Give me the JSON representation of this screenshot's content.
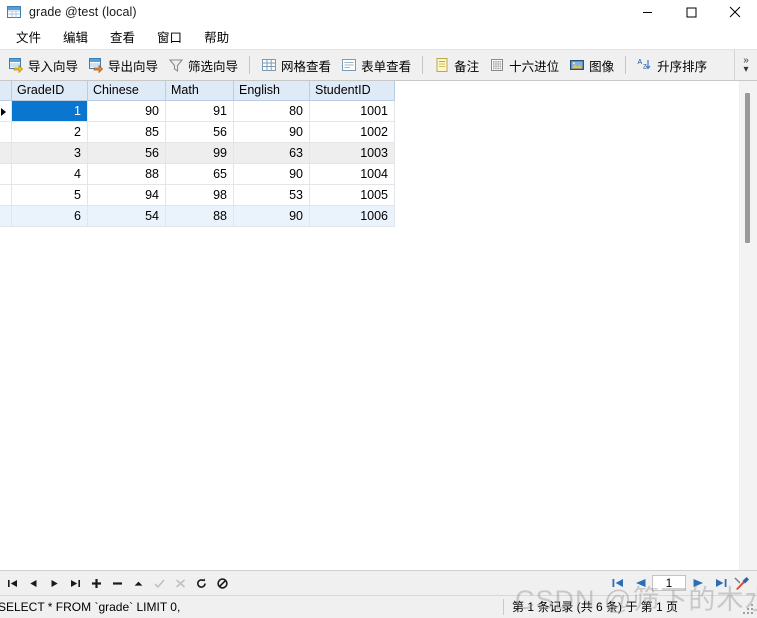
{
  "window": {
    "title": "grade @test (local)",
    "icon": "table-grid-icon",
    "minimize_label": "─",
    "maximize_label": "□",
    "close_label": "✕"
  },
  "menubar": {
    "items": [
      {
        "label": "文件",
        "name": "menu-file"
      },
      {
        "label": "编辑",
        "name": "menu-edit"
      },
      {
        "label": "查看",
        "name": "menu-view"
      },
      {
        "label": "窗口",
        "name": "menu-window"
      },
      {
        "label": "帮助",
        "name": "menu-help"
      }
    ]
  },
  "toolbar": {
    "import_wizard": "导入向导",
    "export_wizard": "导出向导",
    "filter_wizard": "筛选向导",
    "grid_view": "网格查看",
    "form_view": "表单查看",
    "memo": "备注",
    "hex": "十六进位",
    "image": "图像",
    "sort_asc": "升序排序",
    "overflow_label": "»",
    "overflow_caret": "▾"
  },
  "grid": {
    "columns": [
      "GradeID",
      "Chinese",
      "Math",
      "English",
      "StudentID"
    ],
    "rows": [
      {
        "GradeID": "1",
        "Chinese": "90",
        "Math": "91",
        "English": "80",
        "StudentID": "1001"
      },
      {
        "GradeID": "2",
        "Chinese": "85",
        "Math": "56",
        "English": "90",
        "StudentID": "1002"
      },
      {
        "GradeID": "3",
        "Chinese": "56",
        "Math": "99",
        "English": "63",
        "StudentID": "1003"
      },
      {
        "GradeID": "4",
        "Chinese": "88",
        "Math": "65",
        "English": "90",
        "StudentID": "1004"
      },
      {
        "GradeID": "5",
        "Chinese": "94",
        "Math": "98",
        "English": "53",
        "StudentID": "1005"
      },
      {
        "GradeID": "6",
        "Chinese": "54",
        "Math": "88",
        "English": "90",
        "StudentID": "1006"
      }
    ],
    "selected_row_index": 0,
    "selection_color": "#0a76d0",
    "header_color": "#dfeaf7"
  },
  "navbar": {
    "buttons": [
      {
        "name": "nav-first-record",
        "glyph": "first"
      },
      {
        "name": "nav-prev-record",
        "glyph": "prev"
      },
      {
        "name": "nav-next-record",
        "glyph": "next"
      },
      {
        "name": "nav-last-record",
        "glyph": "last"
      },
      {
        "name": "nav-add-record",
        "glyph": "plus"
      },
      {
        "name": "nav-delete-record",
        "glyph": "minus"
      },
      {
        "name": "nav-apply-up",
        "glyph": "up"
      },
      {
        "name": "nav-confirm",
        "glyph": "check"
      },
      {
        "name": "nav-cancel",
        "glyph": "cross"
      },
      {
        "name": "nav-refresh",
        "glyph": "refresh"
      },
      {
        "name": "nav-stop",
        "glyph": "stop"
      }
    ],
    "page_value": "1"
  },
  "statusbar": {
    "sql": "SELECT * FROM `grade` LIMIT 0, ",
    "record_info": "第 1 条记录 (共 6 条) 于 第 1 页"
  },
  "watermark": {
    "text": "CSDN @筛下的木水"
  }
}
